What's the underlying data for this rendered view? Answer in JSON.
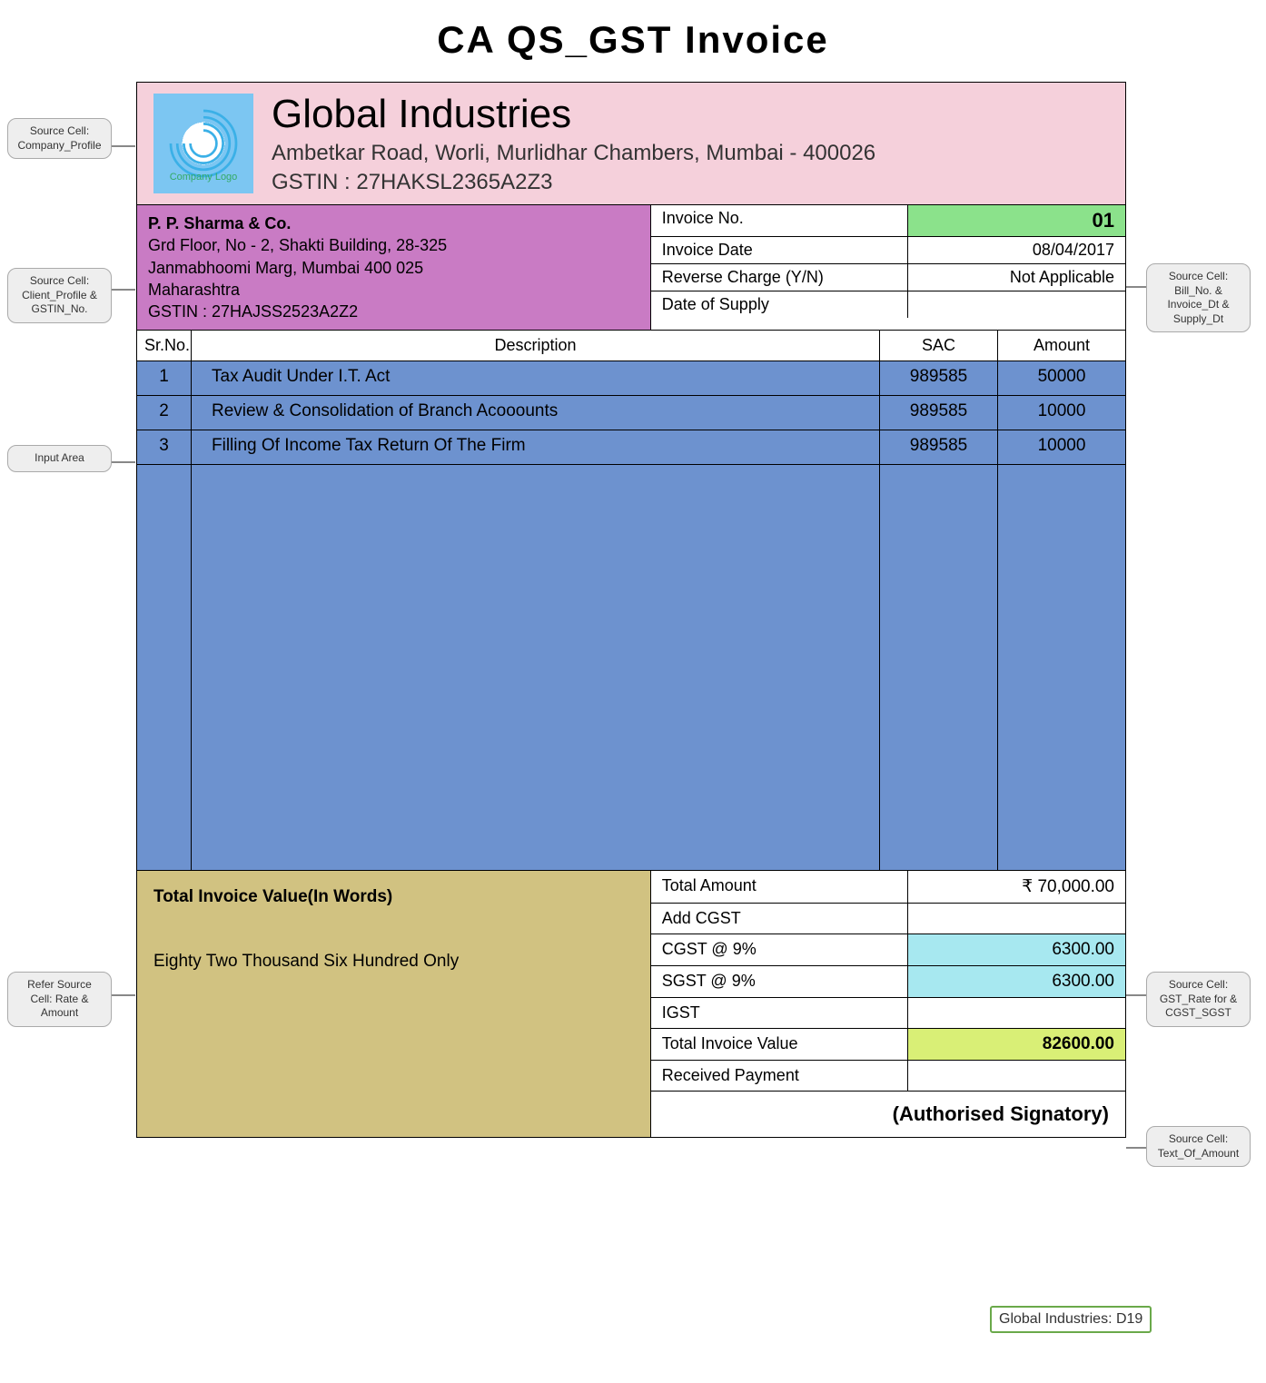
{
  "title": "CA QS_GST Invoice",
  "header": {
    "company": "Global Industries",
    "address": "Ambetkar Road, Worli, Murlidhar Chambers, Mumbai - 400026",
    "gstin": "GSTIN : 27HAKSL2365A2Z3",
    "logo_caption": "Company Logo"
  },
  "client": {
    "name": "P. P. Sharma & Co.",
    "addr1": "Grd Floor, No - 2, Shakti Building, 28-325",
    "addr2": "Janmabhoomi Marg, Mumbai 400 025",
    "state": "Maharashtra",
    "gstin": "GSTIN : 27HAJSS2523A2Z2"
  },
  "meta": {
    "labels": {
      "inv_no": "Invoice No.",
      "inv_date": "Invoice Date",
      "rev": "Reverse Charge (Y/N)",
      "challan": "Date of Supply"
    },
    "values": {
      "inv_no": "01",
      "inv_date": "08/04/2017",
      "rev": "Not Applicable",
      "challan": ""
    }
  },
  "columns": {
    "sr": "Sr.No.",
    "desc": "Description",
    "sac": "SAC",
    "amt": "Amount"
  },
  "items": [
    {
      "sr": "1",
      "desc": "Tax Audit Under I.T. Act",
      "sac": "989585",
      "amt": "50000"
    },
    {
      "sr": "2",
      "desc": "Review & Consolidation of Branch Acooounts",
      "sac": "989585",
      "amt": "10000"
    },
    {
      "sr": "3",
      "desc": "Filling Of Income Tax Return Of The Firm",
      "sac": "989585",
      "amt": "10000"
    }
  ],
  "totals": {
    "words_label": "Total Invoice Value(In Words)",
    "words_value": "Eighty Two Thousand Six Hundred Only",
    "rows": [
      {
        "label": "Total Amount",
        "value": "₹ 70,000.00",
        "cls": ""
      },
      {
        "label": "Add CGST",
        "value": "",
        "cls": ""
      },
      {
        "label": "CGST @ 9%",
        "value": "6300.00",
        "cls": "cyan"
      },
      {
        "label": "SGST @ 9%",
        "value": "6300.00",
        "cls": "cyan"
      },
      {
        "label": "IGST",
        "value": "",
        "cls": ""
      },
      {
        "label": "Total Invoice Value",
        "value": "82600.00",
        "cls": "lime"
      },
      {
        "label": "Received Payment",
        "value": "",
        "cls": ""
      }
    ],
    "signature": "(Authorised Signatory)"
  },
  "callouts": {
    "c1": "Source Cell: Company_Profile",
    "c2": "Source Cell: Client_Profile & GSTIN_No.",
    "c3": "Input Area",
    "c4": "Refer Source Cell: Rate & Amount",
    "c5": "Source Cell: Bill_No. & Invoice_Dt & Supply_Dt",
    "c6": "Source Cell: GST_Rate for & CGST_SGST",
    "c7": "Source Cell: Text_Of_Amount"
  },
  "cell_ref": "Global Industries: D19"
}
